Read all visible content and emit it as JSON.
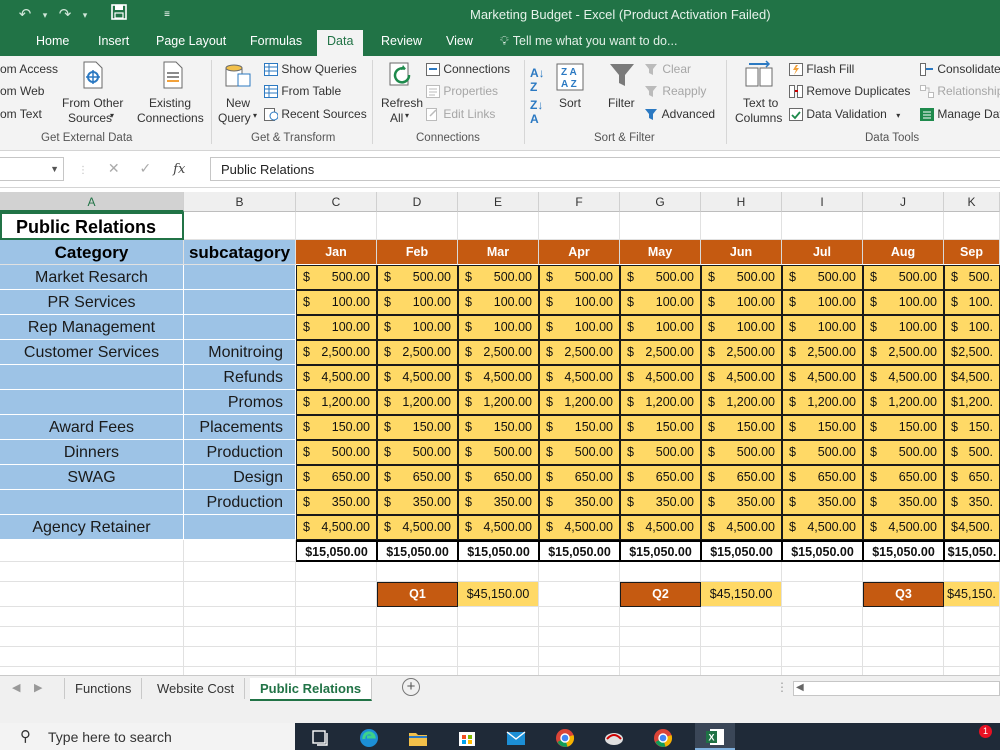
{
  "app": {
    "title": "Marketing Budget - Excel (Product Activation Failed)",
    "tabs": [
      "Home",
      "Insert",
      "Page Layout",
      "Formulas",
      "Data",
      "Review",
      "View"
    ],
    "active_tab": "Data",
    "tell_me": "Tell me what you want to do..."
  },
  "ribbon": {
    "get_external": {
      "items": [
        "om Access",
        "om Web",
        "om Text"
      ],
      "from_other_1": "From Other",
      "from_other_2": "Sources",
      "existing_1": "Existing",
      "existing_2": "Connections",
      "label": "Get External Data"
    },
    "get_transform": {
      "new_query_1": "New",
      "new_query_2": "Query",
      "show_queries": "Show Queries",
      "from_table": "From Table",
      "recent_sources": "Recent Sources",
      "label": "Get & Transform"
    },
    "connections": {
      "refresh_1": "Refresh",
      "refresh_2": "All",
      "connections": "Connections",
      "properties": "Properties",
      "edit_links": "Edit Links",
      "label": "Connections"
    },
    "sort_filter": {
      "sort": "Sort",
      "filter": "Filter",
      "clear": "Clear",
      "reapply": "Reapply",
      "advanced": "Advanced",
      "label": "Sort & Filter"
    },
    "data_tools": {
      "text_to_columns_1": "Text to",
      "text_to_columns_2": "Columns",
      "flash_fill": "Flash Fill",
      "remove_duplicates": "Remove Duplicates",
      "data_validation": "Data Validation",
      "consolidate": "Consolidate",
      "relationships": "Relationships",
      "manage_data": "Manage Dat",
      "label": "Data Tools"
    }
  },
  "formula_bar": {
    "fx": "fx",
    "value": "Public Relations"
  },
  "columns": [
    "A",
    "B",
    "C",
    "D",
    "E",
    "F",
    "G",
    "H",
    "I",
    "J",
    "K"
  ],
  "sheet": {
    "title": "Public Relations",
    "header_category": "Category",
    "header_subcategory": "subcatagory",
    "months": [
      "Jan",
      "Feb",
      "Mar",
      "Apr",
      "May",
      "Jun",
      "Jul",
      "Aug",
      "Sep"
    ],
    "rows": [
      {
        "category": "Market Resarch",
        "sub": "",
        "values": [
          "500.00",
          "500.00",
          "500.00",
          "500.00",
          "500.00",
          "500.00",
          "500.00",
          "500.00",
          "500."
        ]
      },
      {
        "category": "PR Services",
        "sub": "",
        "values": [
          "100.00",
          "100.00",
          "100.00",
          "100.00",
          "100.00",
          "100.00",
          "100.00",
          "100.00",
          "100."
        ]
      },
      {
        "category": "Rep Management",
        "sub": "",
        "values": [
          "100.00",
          "100.00",
          "100.00",
          "100.00",
          "100.00",
          "100.00",
          "100.00",
          "100.00",
          "100."
        ]
      },
      {
        "category": "Customer Services",
        "sub": "Monitroing",
        "values": [
          "2,500.00",
          "2,500.00",
          "2,500.00",
          "2,500.00",
          "2,500.00",
          "2,500.00",
          "2,500.00",
          "2,500.00",
          "2,500."
        ]
      },
      {
        "category": "",
        "sub": "Refunds",
        "values": [
          "4,500.00",
          "4,500.00",
          "4,500.00",
          "4,500.00",
          "4,500.00",
          "4,500.00",
          "4,500.00",
          "4,500.00",
          "4,500."
        ]
      },
      {
        "category": "",
        "sub": "Promos",
        "values": [
          "1,200.00",
          "1,200.00",
          "1,200.00",
          "1,200.00",
          "1,200.00",
          "1,200.00",
          "1,200.00",
          "1,200.00",
          "1,200."
        ]
      },
      {
        "category": "Award Fees",
        "sub": "Placements",
        "values": [
          "150.00",
          "150.00",
          "150.00",
          "150.00",
          "150.00",
          "150.00",
          "150.00",
          "150.00",
          "150."
        ]
      },
      {
        "category": "Dinners",
        "sub": "Production",
        "values": [
          "500.00",
          "500.00",
          "500.00",
          "500.00",
          "500.00",
          "500.00",
          "500.00",
          "500.00",
          "500."
        ]
      },
      {
        "category": "SWAG",
        "sub": "Design",
        "values": [
          "650.00",
          "650.00",
          "650.00",
          "650.00",
          "650.00",
          "650.00",
          "650.00",
          "650.00",
          "650."
        ]
      },
      {
        "category": "",
        "sub": "Production",
        "values": [
          "350.00",
          "350.00",
          "350.00",
          "350.00",
          "350.00",
          "350.00",
          "350.00",
          "350.00",
          "350."
        ]
      },
      {
        "category": "Agency Retainer",
        "sub": "",
        "values": [
          "4,500.00",
          "4,500.00",
          "4,500.00",
          "4,500.00",
          "4,500.00",
          "4,500.00",
          "4,500.00",
          "4,500.00",
          "4,500."
        ]
      }
    ],
    "totals": [
      "$15,050.00",
      "$15,050.00",
      "$15,050.00",
      "$15,050.00",
      "$15,050.00",
      "$15,050.00",
      "$15,050.00",
      "$15,050.00",
      "$15,050."
    ],
    "quarters": [
      {
        "label": "Q1",
        "value": "$45,150.00"
      },
      {
        "label": "Q2",
        "value": "$45,150.00"
      },
      {
        "label": "Q3",
        "value": "$45,150."
      }
    ],
    "currency_symbol": "$"
  },
  "sheet_tabs": [
    "Functions",
    "Website Cost",
    "Public Relations"
  ],
  "active_sheet": "Public Relations",
  "taskbar": {
    "search_placeholder": "Type here to search",
    "badge": "1"
  },
  "colors": {
    "excel_green": "#217346",
    "category_blue": "#9dc3e6",
    "month_orange": "#c55a11",
    "money_yellow": "#ffd966"
  }
}
